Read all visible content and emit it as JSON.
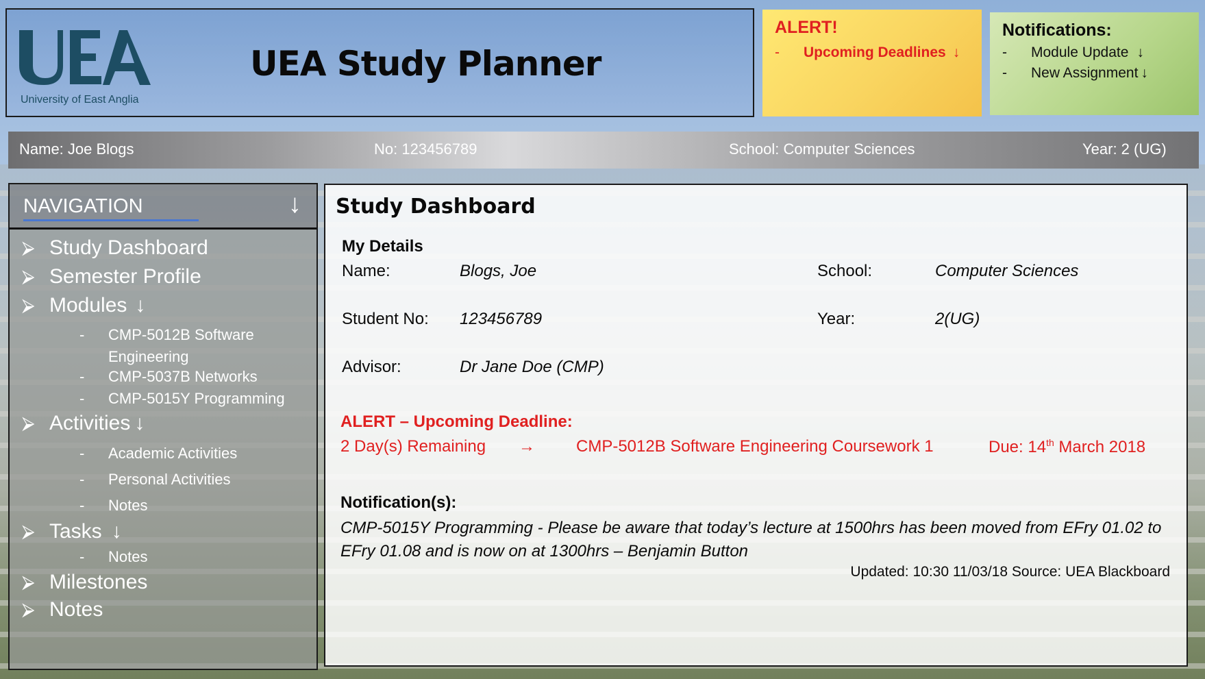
{
  "header": {
    "logo_text": "University of East Anglia",
    "title": "UEA Study Planner"
  },
  "alert_box": {
    "title": "ALERT!",
    "dash": "-",
    "item": "Upcoming Deadlines",
    "arrow": "↓"
  },
  "notifications_box": {
    "title": "Notifications:",
    "items": [
      {
        "dash": "-",
        "label": "Module Update",
        "arrow": "↓"
      },
      {
        "dash": "-",
        "label": "New Assignment",
        "arrow": "↓"
      }
    ]
  },
  "student_bar": {
    "name": "Name: Joe Blogs",
    "number": "No: 123456789",
    "school": "School: Computer Sciences",
    "year": "Year: 2 (UG)"
  },
  "navigation": {
    "header": "NAVIGATION",
    "toggle": "↓",
    "bullet": "⮚",
    "items": [
      {
        "label": "Study Dashboard"
      },
      {
        "label": "Semester Profile"
      },
      {
        "label": "Modules",
        "arrow": "↓"
      },
      {
        "label": "Activities",
        "arrow": "↓"
      },
      {
        "label": "Tasks",
        "arrow": "↓"
      },
      {
        "label": "Milestones"
      },
      {
        "label": "Notes"
      }
    ],
    "modules_sub": [
      "CMP-5012B Software Engineering",
      "CMP-5037B Networks",
      "CMP-5015Y Programming"
    ],
    "activities_sub": [
      "Academic Activities",
      "Personal Activities",
      "Notes"
    ],
    "tasks_sub": [
      "Notes"
    ],
    "sub_dash": "-"
  },
  "dashboard": {
    "title": "Study Dashboard",
    "details_heading": "My Details",
    "name_label": "Name:",
    "name_value": "Blogs, Joe",
    "school_label": "School:",
    "school_value": "Computer Sciences",
    "student_no_label": "Student No:",
    "student_no_value": "123456789",
    "year_label": "Year:",
    "year_value": "2(UG)",
    "advisor_label": "Advisor:",
    "advisor_value": "Dr Jane Doe (CMP)",
    "alert_heading": "ALERT – Upcoming Deadline:",
    "alert_remaining": "2 Day(s) Remaining",
    "alert_arrow": "→",
    "alert_module": "CMP-5012B Software Engineering Coursework 1",
    "alert_due_prefix": "Due: 14",
    "alert_due_sup": "th",
    "alert_due_suffix": " March 2018",
    "notif_heading": "Notification(s):",
    "notif_message": "CMP-5015Y Programming - Please be aware that today’s lecture at 1500hrs has been moved from EFry 01.02 to EFry 01.08 and is now on at 1300hrs – Benjamin Button",
    "updated": "Updated: 10:30 11/03/18 Source: UEA Blackboard"
  }
}
